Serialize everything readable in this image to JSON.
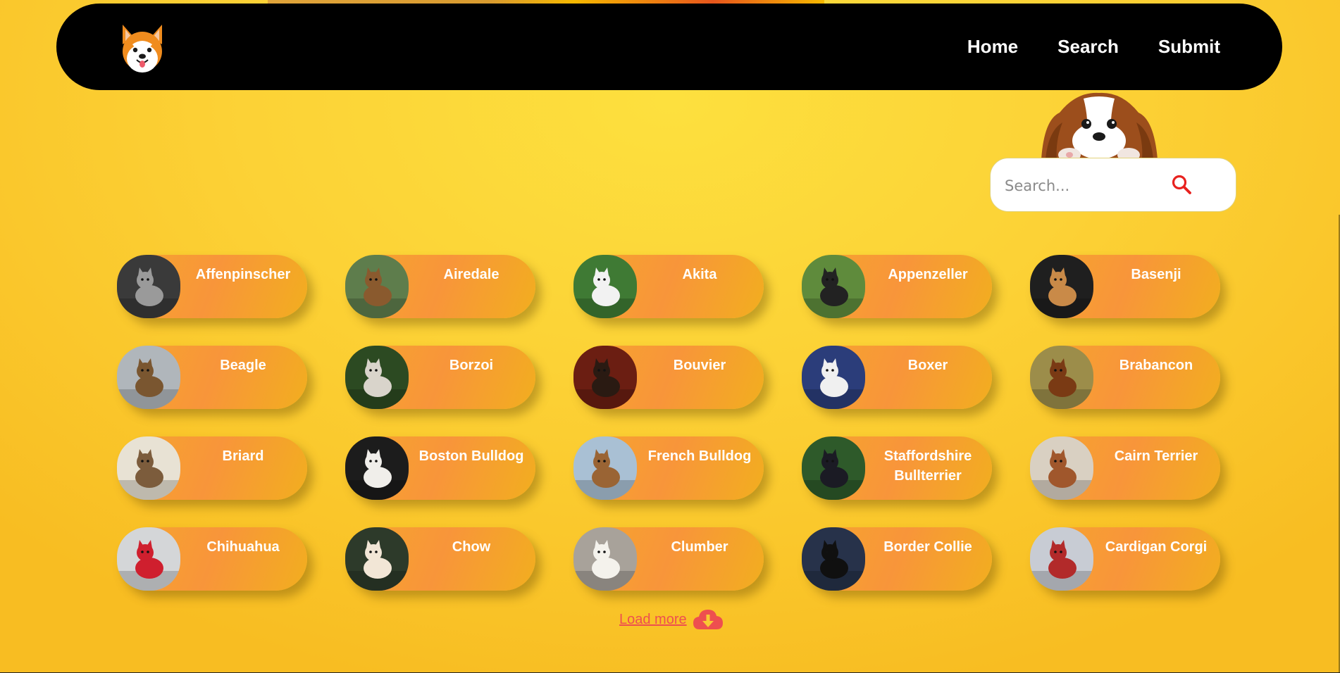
{
  "nav": {
    "links": [
      "Home",
      "Search",
      "Submit"
    ]
  },
  "search": {
    "placeholder": "Search..."
  },
  "breeds": [
    {
      "name": "Affenpinscher",
      "bg": "#3a3a3a",
      "fg": "#9a9a9a"
    },
    {
      "name": "Airedale",
      "bg": "#5e7d4c",
      "fg": "#8a5a2e"
    },
    {
      "name": "Akita",
      "bg": "#3f7a34",
      "fg": "#f2f2f2"
    },
    {
      "name": "Appenzeller",
      "bg": "#5f8b3c",
      "fg": "#222222"
    },
    {
      "name": "Basenji",
      "bg": "#1f1f1f",
      "fg": "#c98a48"
    },
    {
      "name": "Beagle",
      "bg": "#b0b6bb",
      "fg": "#7a5630"
    },
    {
      "name": "Borzoi",
      "bg": "#2c4a22",
      "fg": "#d9d4cb"
    },
    {
      "name": "Bouvier",
      "bg": "#6b1e12",
      "fg": "#2a1a12"
    },
    {
      "name": "Boxer",
      "bg": "#2b3d7a",
      "fg": "#f0f0f0"
    },
    {
      "name": "Brabancon",
      "bg": "#9c8d4a",
      "fg": "#7a3a14"
    },
    {
      "name": "Briard",
      "bg": "#e8e2d4",
      "fg": "#7c5c3c"
    },
    {
      "name": "Boston Bulldog",
      "bg": "#1c1c1c",
      "fg": "#f0eeea"
    },
    {
      "name": "French Bulldog",
      "bg": "#a9c0d4",
      "fg": "#9a6434"
    },
    {
      "name": "Staffordshire Bullterrier",
      "bg": "#2e5a2a",
      "fg": "#1b1b24"
    },
    {
      "name": "Cairn Terrier",
      "bg": "#d9d0c2",
      "fg": "#a0572c"
    },
    {
      "name": "Chihuahua",
      "bg": "#d4d6d8",
      "fg": "#cf1f2e"
    },
    {
      "name": "Chow",
      "bg": "#2d3a2a",
      "fg": "#f2e6d6"
    },
    {
      "name": "Clumber",
      "bg": "#a8a29a",
      "fg": "#f4f2ec"
    },
    {
      "name": "Border Collie",
      "bg": "#27324a",
      "fg": "#101010"
    },
    {
      "name": "Cardigan Corgi",
      "bg": "#c8ccd4",
      "fg": "#b22a2a"
    }
  ],
  "load_more": {
    "label": "Load more"
  },
  "colors": {
    "accent": "#ee4f4f",
    "card_start": "#f6a72c",
    "card_mid": "#f8953a",
    "navbar": "#000000"
  }
}
